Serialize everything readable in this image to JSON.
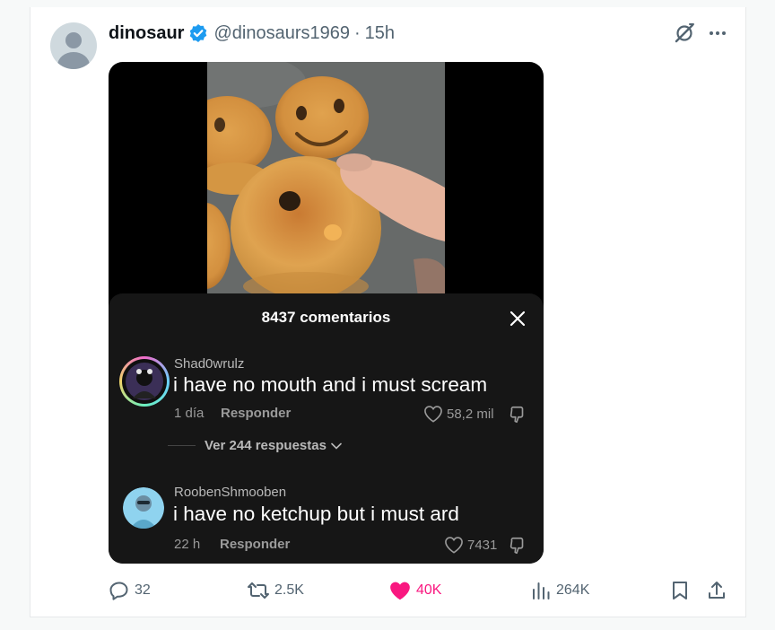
{
  "post": {
    "display_name": "dinosaur",
    "handle": "@dinosaurs1969",
    "separator": "·",
    "time": "15h"
  },
  "comments_sheet": {
    "title": "8437 comentarios",
    "comments": [
      {
        "username": "Shad0wrulz",
        "text": "i have no mouth and i must scream",
        "age": "1 día",
        "reply_label": "Responder",
        "likes": "58,2 mil"
      },
      {
        "username": "RoobenShmooben",
        "text": "i have no ketchup but i must ard",
        "age": "22 h",
        "reply_label": "Responder",
        "likes": "7431"
      }
    ],
    "view_replies": "Ver 244 respuestas"
  },
  "actions": {
    "replies": "32",
    "reposts": "2.5K",
    "likes": "40K",
    "views": "264K"
  },
  "colors": {
    "verified": "#1d9bf0",
    "like_active": "#f91880",
    "secondary_text": "#536471",
    "sheet_bg": "#161616"
  },
  "icons": [
    "verified-badge-icon",
    "grok-icon",
    "more-icon",
    "close-icon",
    "heart-outline-icon",
    "dislike-icon",
    "chevron-down-icon",
    "reply-icon",
    "repost-icon",
    "heart-filled-icon",
    "views-icon",
    "bookmark-icon",
    "share-icon"
  ]
}
